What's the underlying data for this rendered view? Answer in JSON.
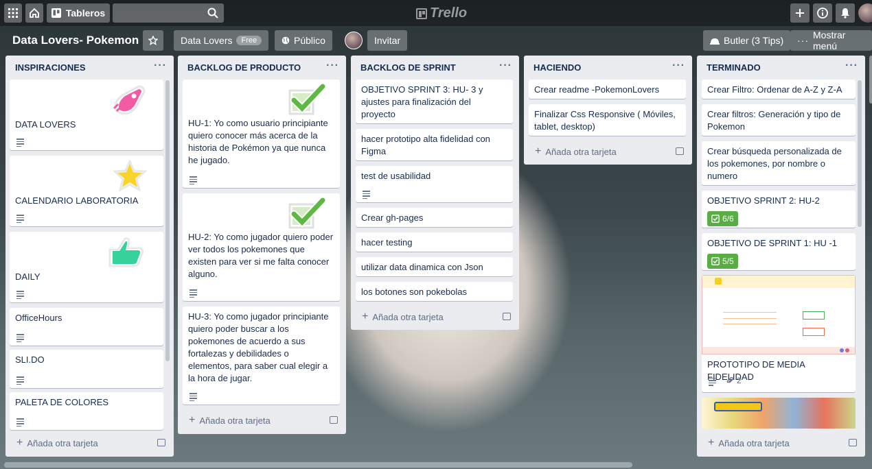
{
  "topbar": {
    "boards_label": "Tableros",
    "logo_text": "Trello"
  },
  "board": {
    "name": "Data Lovers- Pokemon",
    "team": "Data Lovers",
    "plan": "Free",
    "visibility": "Público",
    "invite": "Invitar",
    "butler": "Butler (3 Tips)",
    "menu": "Mostrar menú"
  },
  "add_card_label": "Añada otra tarjeta",
  "lists": [
    {
      "title": "INSPIRACIONES",
      "cards": [
        "DATA LOVERS",
        "CALENDARIO LABORATORIA",
        "DAILY",
        "OfficeHours",
        "SLI.DO",
        "PALETA DE COLORES"
      ]
    },
    {
      "title": "BACKLOG DE PRODUCTO",
      "cards": [
        "HU-1: Yo como usuario principiante quiero conocer más acerca de la historia de Pokémon ya que nunca he jugado.",
        "HU-2: Yo como jugador quiero poder ver todos los pokemones que existen para ver si me falta conocer alguno.",
        "HU-3: Yo como jugador principiante quiero poder buscar a los pokemones de acuerdo a sus fortalezas y debilidades o elementos, para saber cual elegir a la hora de jugar."
      ]
    },
    {
      "title": "BACKLOG DE SPRINT",
      "cards": [
        "OBJETIVO SPRINT 3: HU- 3 y ajustes para finalización del proyecto",
        "hacer prototipo alta fidelidad con Figma",
        "test de usabilidad",
        "Crear gh-pages",
        "hacer testing",
        "utilizar data dinamica con Json",
        "los botones son pokebolas"
      ]
    },
    {
      "title": "HACIENDO",
      "cards": [
        "Crear readme -PokemonLovers",
        "Finalizar Css Responsive ( Móviles, tablet, desktop)"
      ]
    },
    {
      "title": "TERMINADO",
      "cards": [
        "Crear Filtro: Ordenar de A-Z y Z-A",
        "Crear filtros: Generación y tipo de Pokemon",
        "Crear búsqueda personalizada de los pokemones, por nombre o numero",
        "OBJETIVO SPRINT 2: HU-2",
        "OBJETIVO DE SPRINT 1: HU -1",
        "PROTOTIPO DE MEDIA FIDELIDAD"
      ],
      "badges": {
        "sprint2": "6/6",
        "sprint1": "5/5",
        "attachments": "2"
      }
    }
  ],
  "colors": {
    "accent_green": "#5aac44",
    "list_bg": "#ebecf0"
  },
  "icons": [
    "apps-grid-icon",
    "home-icon",
    "board-icon",
    "search-icon",
    "plus-icon",
    "info-icon",
    "bell-icon",
    "star-icon",
    "globe-icon",
    "butler-icon",
    "more-icon",
    "rocket-sticker",
    "star-sticker",
    "thumbs-up-sticker",
    "check-sticker",
    "description-icon",
    "template-icon",
    "checklist-icon",
    "attachment-icon"
  ]
}
